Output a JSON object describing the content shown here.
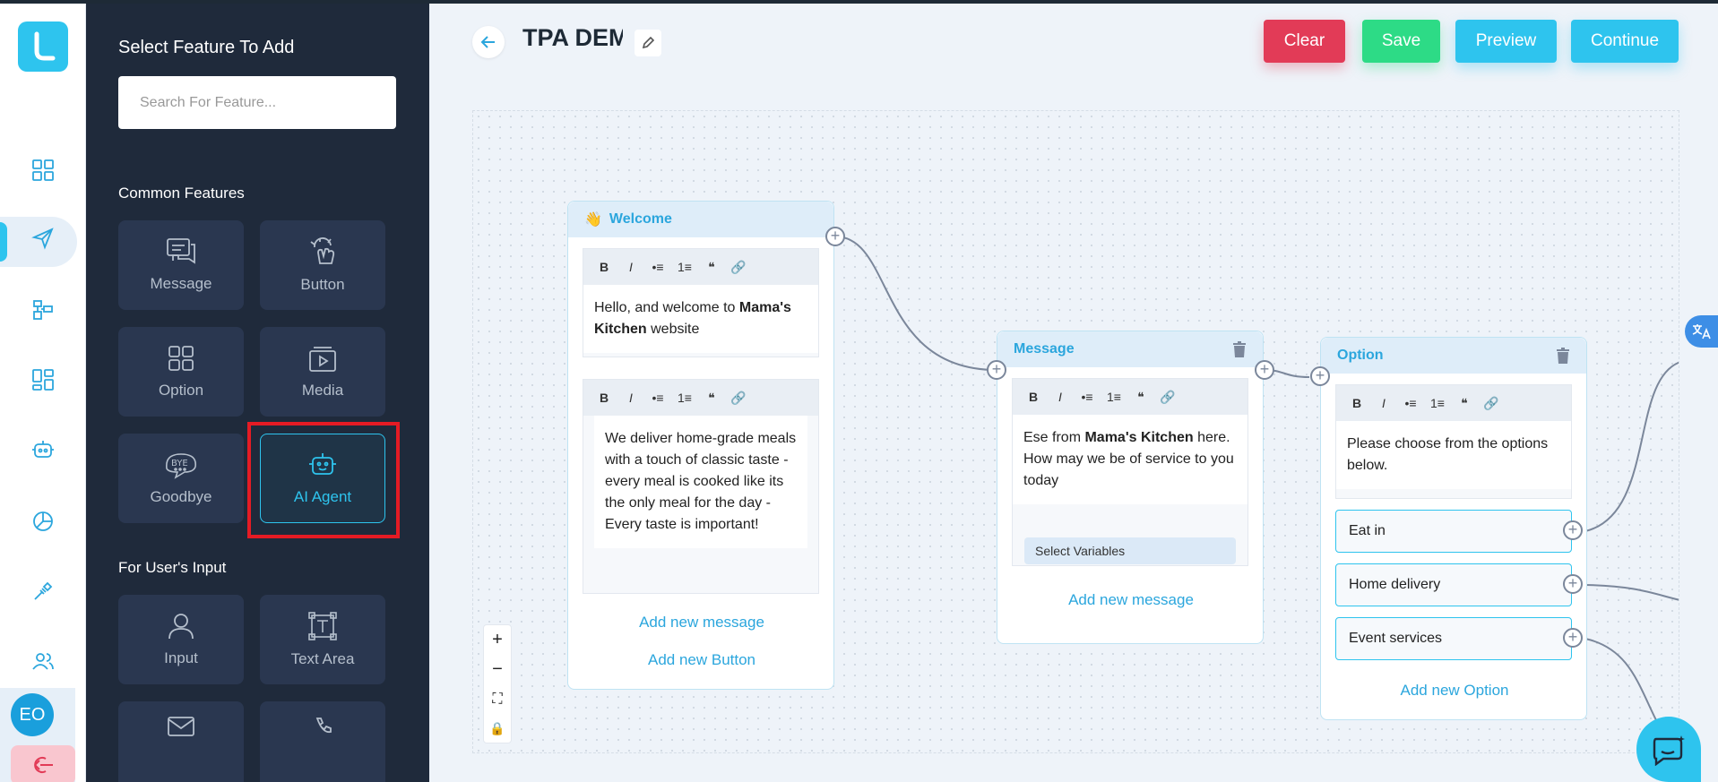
{
  "sidebar": {
    "logo_letter": "L",
    "avatar_initials": "EO",
    "icons": [
      "dashboard-icon",
      "send-icon",
      "builder-icon",
      "templates-icon",
      "bot-icon",
      "analytics-icon",
      "integrations-icon",
      "users-icon"
    ]
  },
  "panel": {
    "title": "Select Feature To Add",
    "search_placeholder": "Search For Feature...",
    "common_title": "Common Features",
    "common": [
      {
        "label": "Message",
        "icon": "message-icon"
      },
      {
        "label": "Button",
        "icon": "button-icon"
      },
      {
        "label": "Option",
        "icon": "option-icon"
      },
      {
        "label": "Media",
        "icon": "media-icon"
      },
      {
        "label": "Goodbye",
        "icon": "goodbye-icon"
      },
      {
        "label": "AI Agent",
        "icon": "ai-agent-icon"
      }
    ],
    "input_title": "For User's Input",
    "inputs": [
      {
        "label": "Input",
        "icon": "user-input-icon"
      },
      {
        "label": "Text Area",
        "icon": "text-area-icon"
      }
    ]
  },
  "header": {
    "title": "TPA DEMO",
    "buttons": {
      "clear": "Clear",
      "save": "Save",
      "preview": "Preview",
      "continue": "Continue"
    }
  },
  "nodes": {
    "welcome": {
      "title": "Welcome",
      "emoji": "👋",
      "message1": {
        "pre": "Hello, and welcome to ",
        "bold": "Mama's Kitchen",
        "post": " website"
      },
      "message2": "We deliver home-grade meals with a touch of classic taste - every meal is cooked like its the only meal for the day - Every taste is important!",
      "add_message": "Add new message",
      "add_button": "Add new Button"
    },
    "message": {
      "title": "Message",
      "text": {
        "pre": "Ese from ",
        "bold": "Mama's Kitchen",
        "post": " here. How may we be of service to you today"
      },
      "select_variables": "Select Variables",
      "add_message": "Add new message"
    },
    "option": {
      "title": "Option",
      "text": "Please choose from the options below.",
      "options": [
        "Eat in",
        "Home delivery",
        "Event services"
      ],
      "add_option": "Add new Option"
    }
  },
  "toolbar": [
    "B",
    "I",
    "•≡",
    "1≡",
    "❝",
    "🔗"
  ],
  "zoom": [
    "+",
    "−",
    "⛶",
    "🔒"
  ],
  "colors": {
    "accent": "#2ec4ee",
    "clear": "#e23b57",
    "save": "#2ddb86",
    "panel": "#1f2a3b",
    "highlight": "#e51b24"
  }
}
